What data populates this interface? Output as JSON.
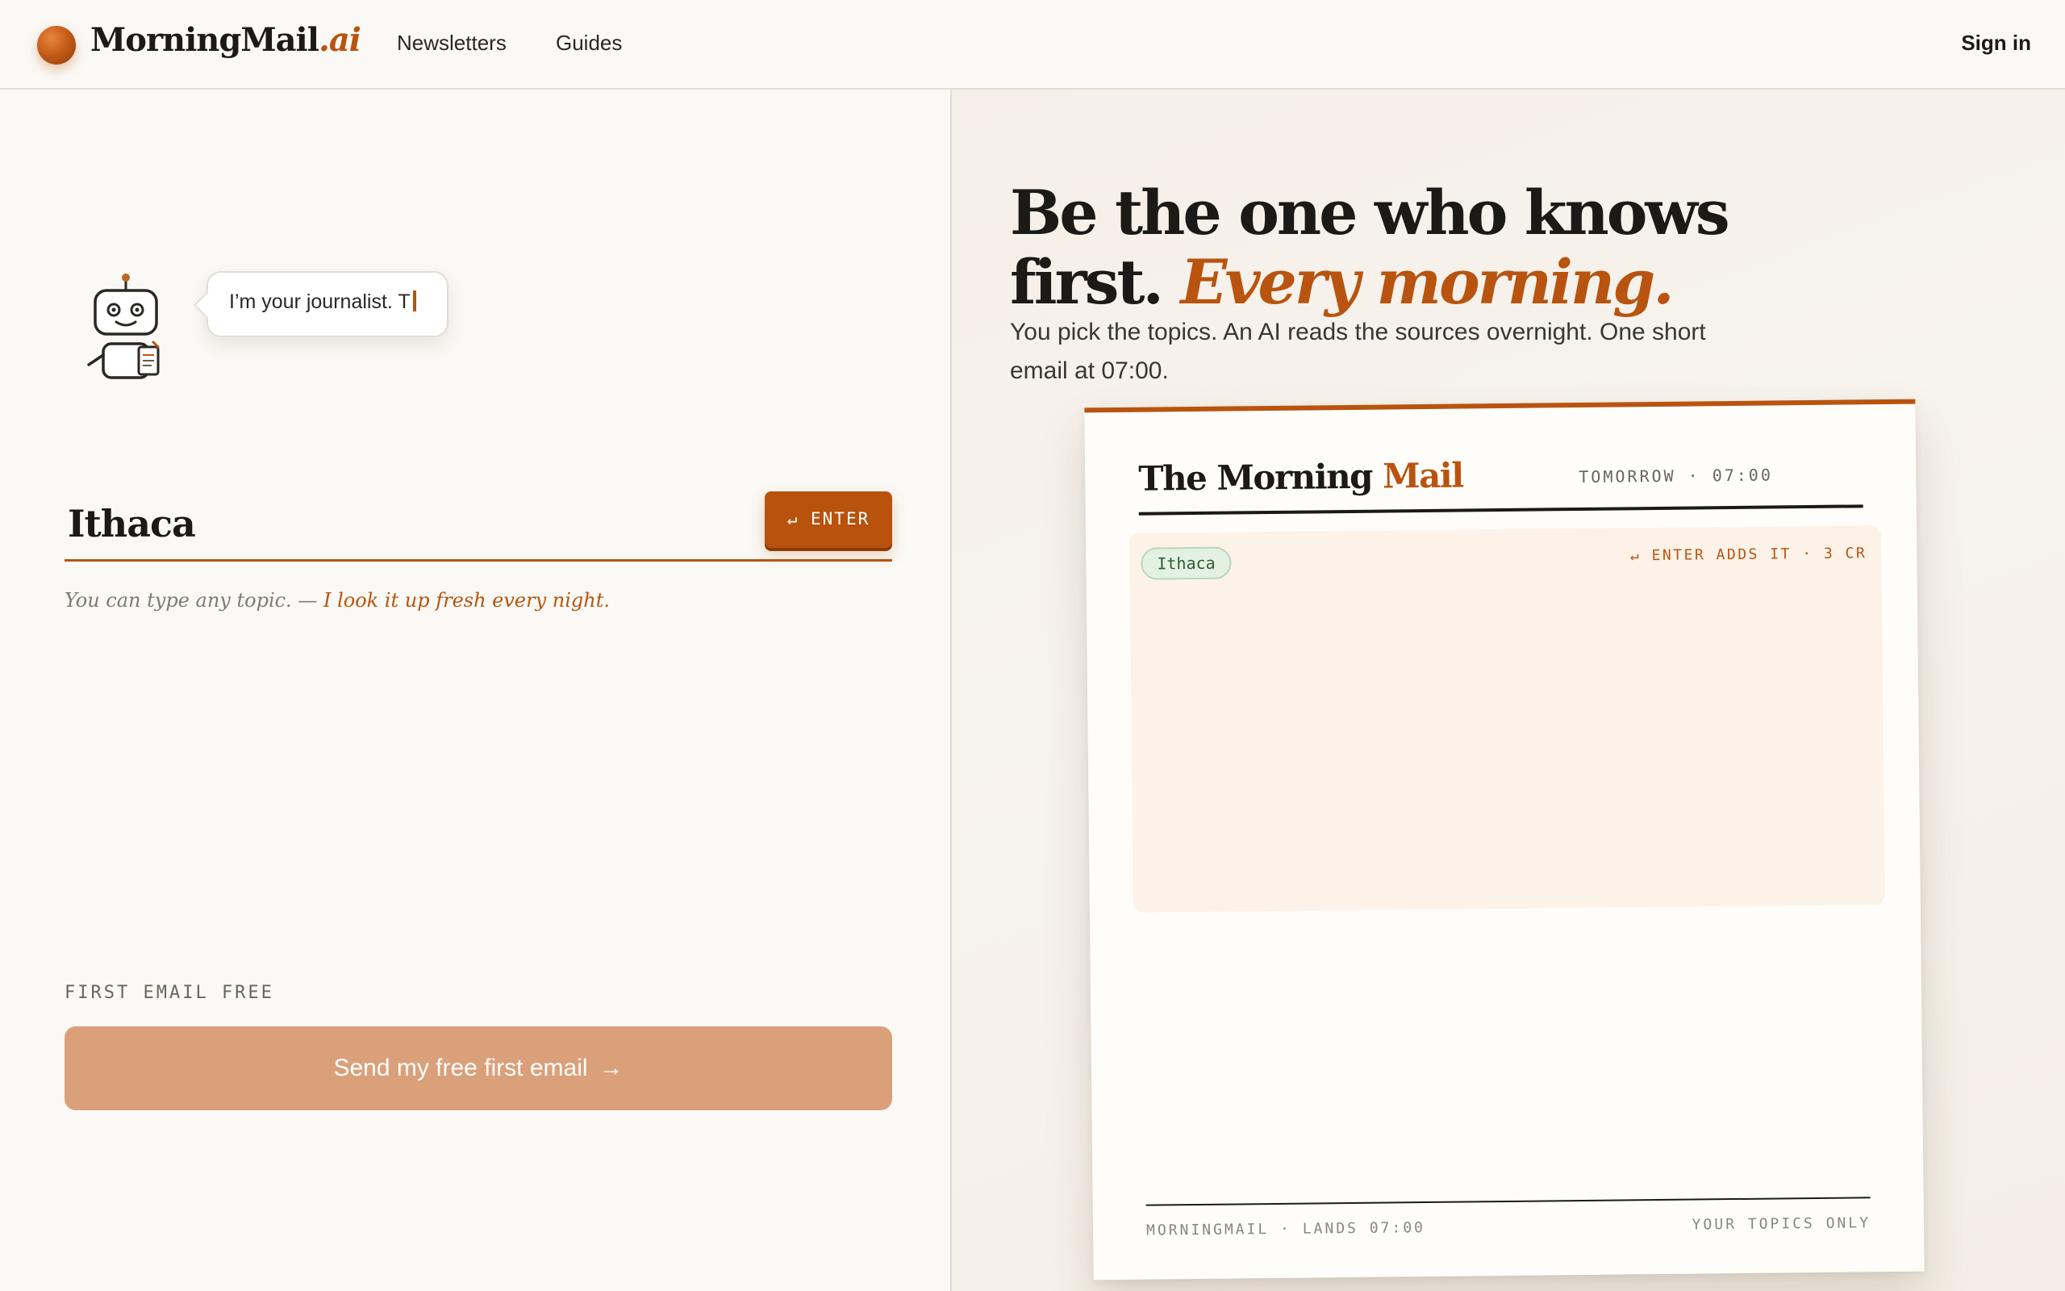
{
  "header": {
    "brand_name": "MorningMail",
    "brand_suffix": ".ai",
    "nav": [
      {
        "label": "Newsletters"
      },
      {
        "label": "Guides"
      }
    ],
    "sign_in_label": "Sign in"
  },
  "left": {
    "bubble_text": "I’m your journalist. T",
    "topic_input_value": "Ithaca",
    "enter_button_label": "↵ ENTER",
    "hint_text": "You can type any topic. —",
    "hint_emphasis": "I look it up fresh every night.",
    "free_label": "FIRST EMAIL FREE",
    "send_button_label": "Send my free first email",
    "send_button_arrow": "→"
  },
  "right": {
    "headline_line1": "Be the one who knows",
    "headline_line2": "first.",
    "headline_accent": "Every morning.",
    "subhead": "You pick the topics. An AI reads the sources overnight. One short email at 07:00.",
    "preview": {
      "title_main": "The Morning",
      "title_accent": "Mail",
      "delivery": "TOMORROW · 07:00",
      "topics": [
        "Ithaca"
      ],
      "enter_note": "↵ ENTER ADDS IT · 3 CR",
      "footer_left": "MORNINGMAIL · LANDS 07:00",
      "footer_right": "YOUR TOPICS ONLY"
    }
  },
  "colors": {
    "accent": "#b8540f",
    "background": "#fbf9f5",
    "chip_bg": "#e3f1e2",
    "send_button": "#daa07a"
  },
  "icons": {
    "logo": "orange-orb-icon",
    "mascot": "robot-journalist-icon",
    "enter": "return-icon",
    "arrow": "arrow-right-icon"
  }
}
